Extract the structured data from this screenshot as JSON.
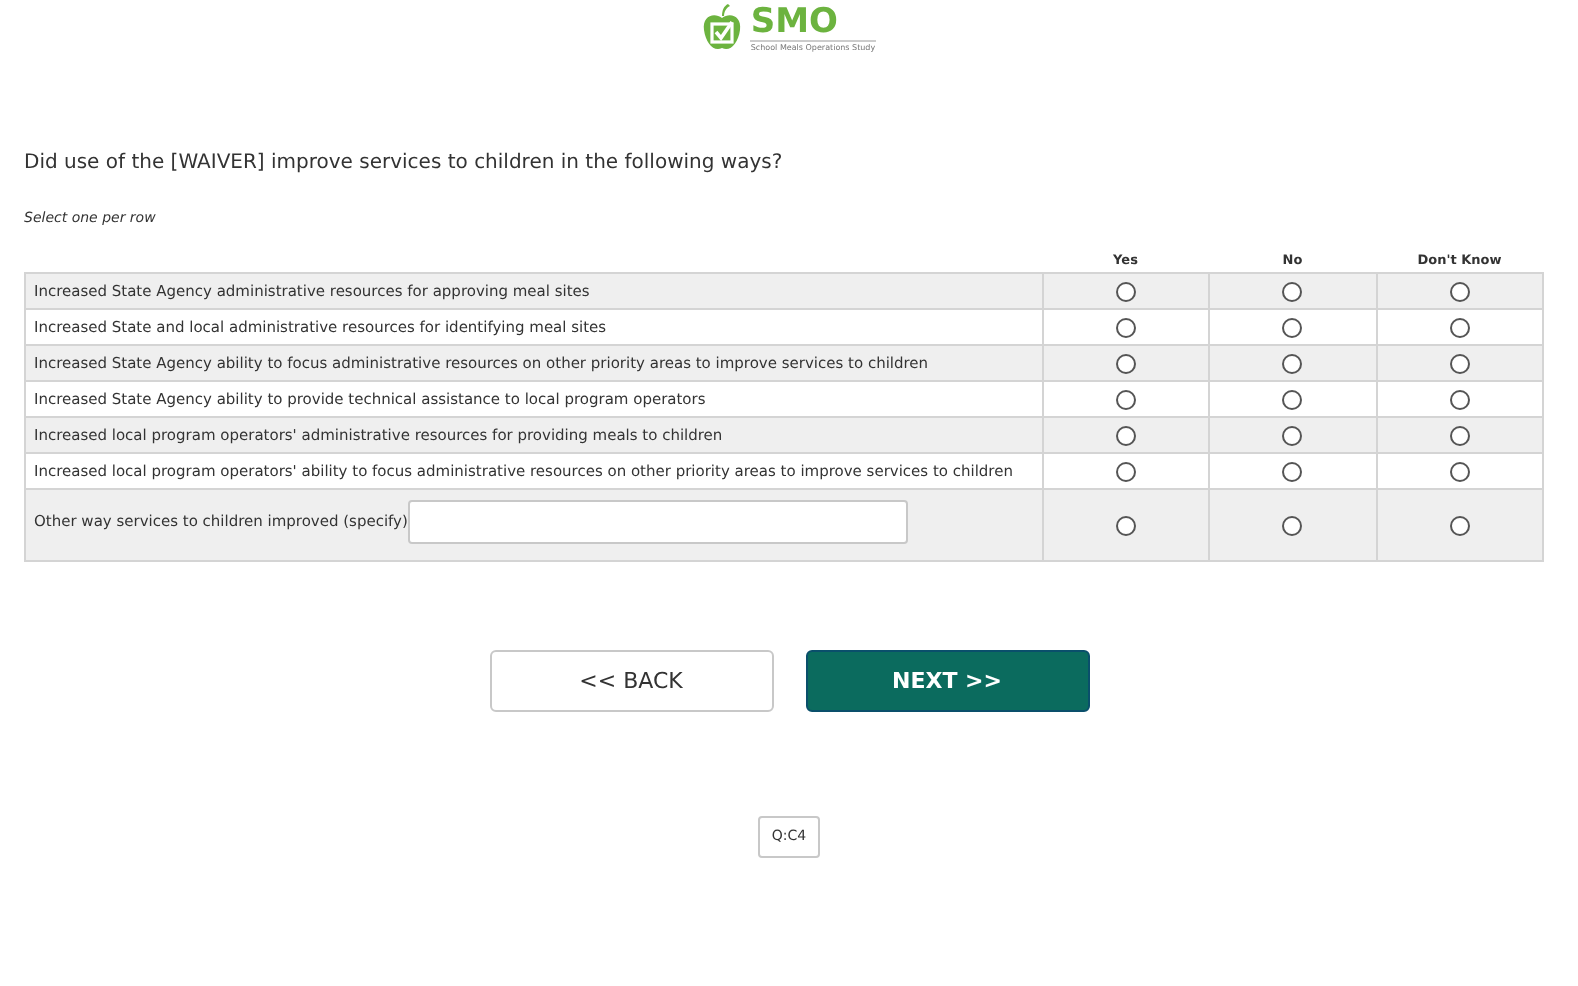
{
  "logo": {
    "title": "SMO",
    "subtitle": "School Meals Operations Study"
  },
  "question": "Did use of the [WAIVER] improve services to children in the following ways?",
  "instruction": "Select one per row",
  "columns": [
    "Yes",
    "No",
    "Don't Know"
  ],
  "rows": [
    {
      "label": "Increased State Agency administrative resources for approving meal sites",
      "options": [
        {
          "selected": false
        },
        {
          "selected": false
        },
        {
          "selected": false
        }
      ]
    },
    {
      "label": "Increased State and local administrative resources for identifying meal sites",
      "options": [
        {
          "selected": false
        },
        {
          "selected": false
        },
        {
          "selected": false
        }
      ]
    },
    {
      "label": "Increased State Agency ability to focus administrative resources on other priority areas to improve services to children",
      "options": [
        {
          "selected": false
        },
        {
          "selected": false
        },
        {
          "selected": false
        }
      ]
    },
    {
      "label": "Increased State Agency ability to provide technical assistance to local program operators",
      "options": [
        {
          "selected": false
        },
        {
          "selected": false
        },
        {
          "selected": false
        }
      ]
    },
    {
      "label": "Increased local program operators' administrative resources for providing meals to children",
      "options": [
        {
          "selected": false
        },
        {
          "selected": false
        },
        {
          "selected": false
        }
      ]
    },
    {
      "label": "Increased local program operators' ability to focus administrative resources on other priority areas to improve services to children",
      "options": [
        {
          "selected": false
        },
        {
          "selected": false
        },
        {
          "selected": false
        }
      ]
    },
    {
      "label": "Other way services to children improved (specify)",
      "kind": "specify",
      "options": [
        {
          "selected": false
        },
        {
          "selected": false
        },
        {
          "selected": false
        }
      ]
    }
  ],
  "buttons": [
    {
      "label": "<< BACK",
      "kind": "secondary"
    },
    {
      "label": "NEXT >>",
      "kind": "primary"
    }
  ],
  "question_id": "Q:C4"
}
